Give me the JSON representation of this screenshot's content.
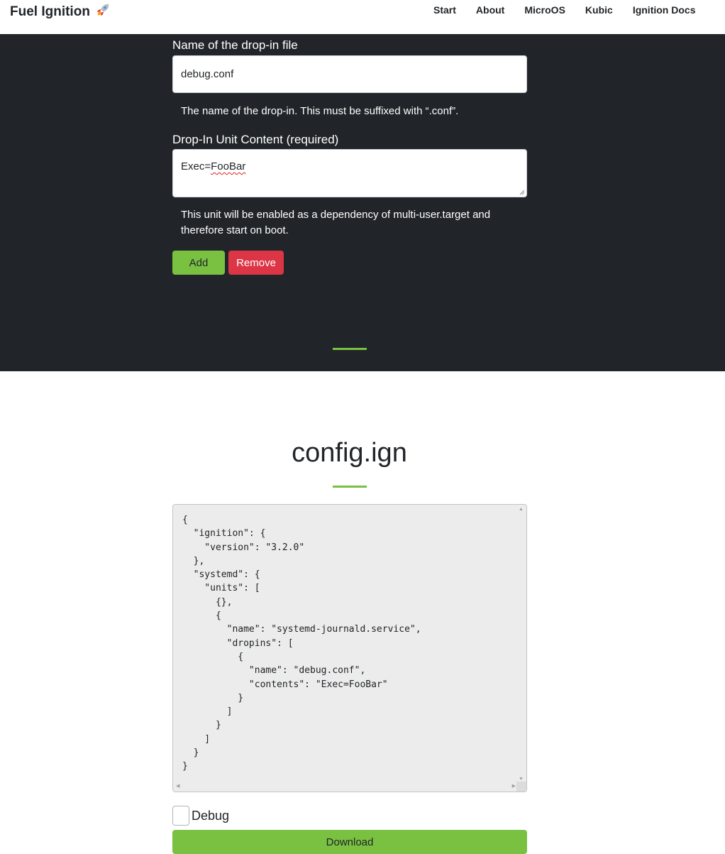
{
  "navbar": {
    "brand": "Fuel Ignition",
    "brand_icon": "rocket-icon",
    "links": [
      "Start",
      "About",
      "MicroOS",
      "Kubic",
      "Ignition Docs"
    ]
  },
  "dropin_form": {
    "name_label": "Name of the drop-in file",
    "name_value": "debug.conf",
    "name_help": "The name of the drop-in. This must be suffixed with “.conf”.",
    "content_label": "Drop-In Unit Content (required)",
    "content_value_prefix": "Exec=",
    "content_value_misspelled": "FooBar",
    "content_help": "This unit will be enabled as a dependency of multi-user.target and therefore start on boot.",
    "add_label": "Add",
    "remove_label": "Remove"
  },
  "config": {
    "title": "config.ign",
    "json_text": "{\n  \"ignition\": {\n    \"version\": \"3.2.0\"\n  },\n  \"systemd\": {\n    \"units\": [\n      {},\n      {\n        \"name\": \"systemd-journald.service\",\n        \"dropins\": [\n          {\n            \"name\": \"debug.conf\",\n            \"contents\": \"Exec=FooBar\"\n          }\n        ]\n      }\n    ]\n  }\n}",
    "debug_label": "Debug",
    "debug_checked": false,
    "download_label": "Download"
  },
  "colors": {
    "accent_green": "#7ac142",
    "danger_red": "#dc3545",
    "dark_bg": "#212529"
  }
}
